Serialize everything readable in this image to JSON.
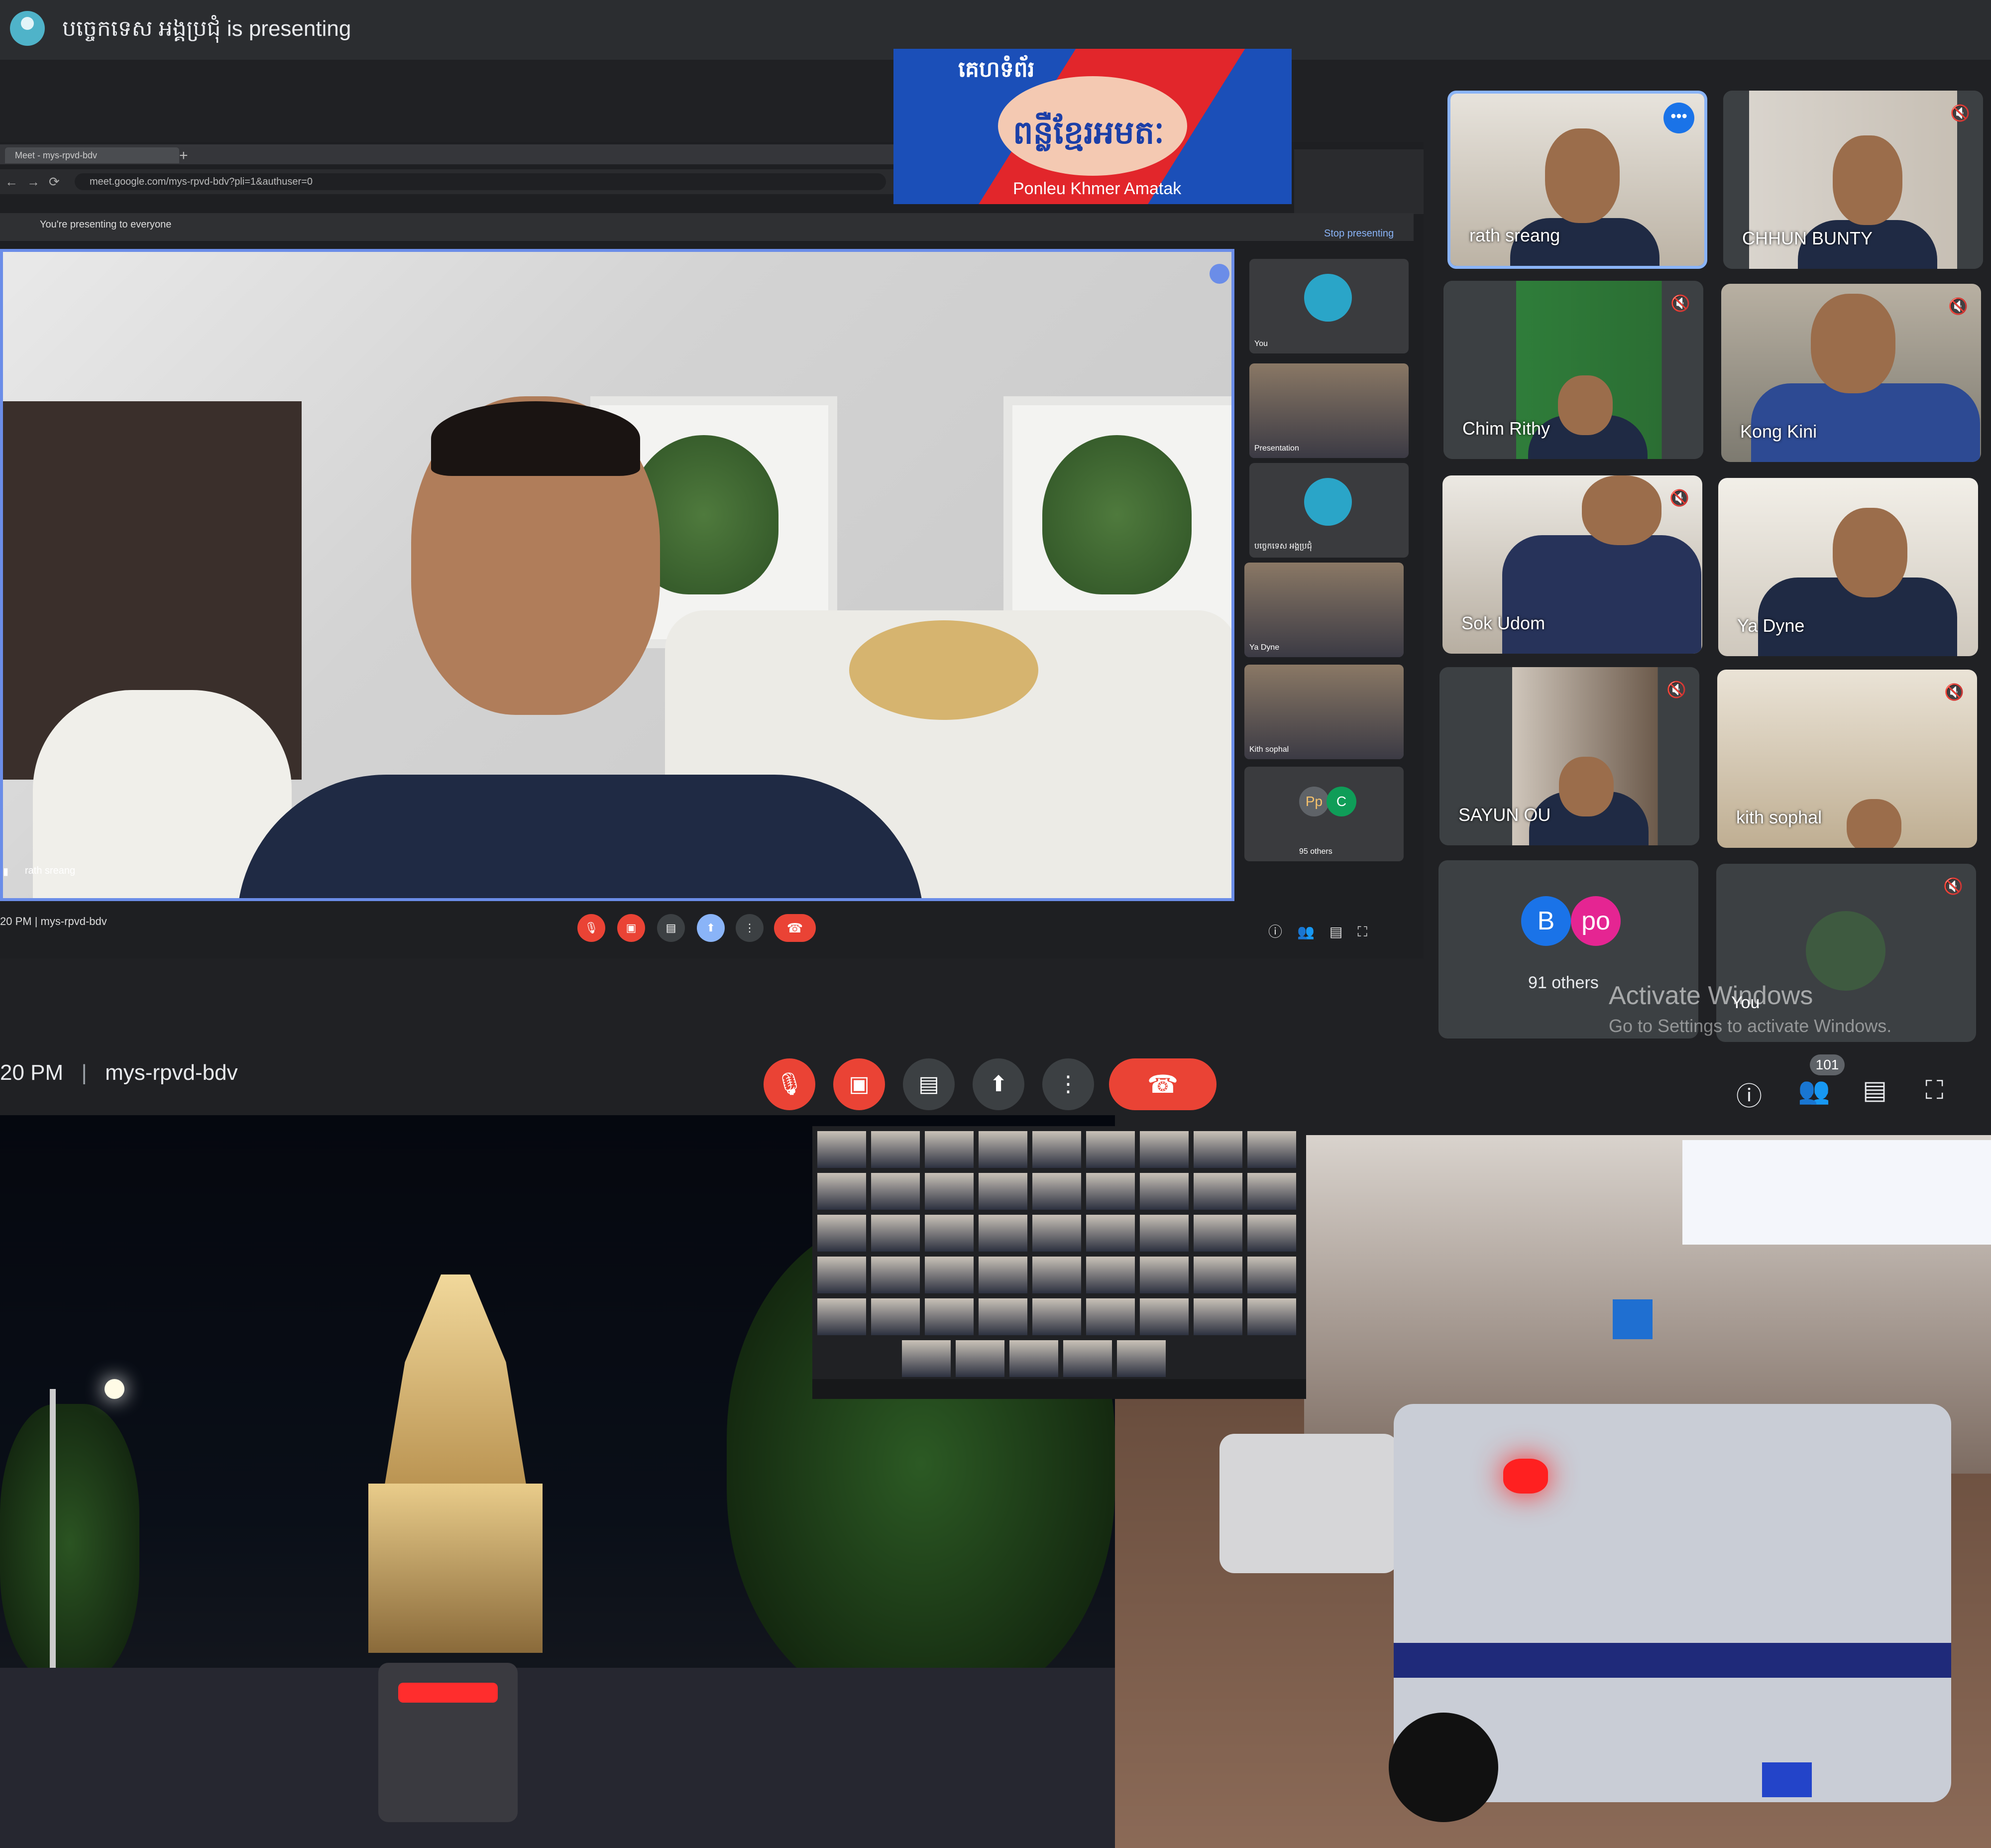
{
  "header": {
    "presenting_text": "បច្ចេកទេស អង្គប្រជុំ is presenting"
  },
  "logo": {
    "top_text": "គេហទំព័រ",
    "main_text": "ពន្លឺខ្មែរអមតៈ",
    "sub_text": "Ponleu Khmer Amatak"
  },
  "shared_screen": {
    "tab_title": "Meet - mys-rpvd-bdv",
    "url": "meet.google.com/mys-rpvd-bdv?pli=1&authuser=0",
    "presenting_bar_text": "You're presenting to everyone",
    "stop_presenting": "Stop presenting",
    "main_speaker_name": "rath sreang",
    "tiles": [
      {
        "name": "You"
      },
      {
        "name": "Presentation"
      },
      {
        "name": "បច្ចេកទេស អង្គប្រជុំ"
      },
      {
        "name": "Ya Dyne"
      },
      {
        "name": "Kith sophal"
      },
      {
        "name": "95 others",
        "avatars": [
          "Pp",
          "C"
        ]
      }
    ],
    "meeting_info": "20 PM | mys-rpvd-bdv"
  },
  "participants": [
    {
      "name": "rath sreang"
    },
    {
      "name": "CHHUN BUNTY"
    },
    {
      "name": "Chim Rithy"
    },
    {
      "name": "Kong Kini"
    },
    {
      "name": "Sok Udom"
    },
    {
      "name": "Ya Dyne"
    },
    {
      "name": "SAYUN OU"
    },
    {
      "name": "kith sophal"
    }
  ],
  "others": {
    "avatar_1": "B",
    "avatar_2": "po",
    "label": "91 others"
  },
  "you_tile": {
    "label": "You"
  },
  "watermark": {
    "line1": "Activate Windows",
    "line2": "Go to Settings to activate Windows."
  },
  "meeting": {
    "time": "20 PM",
    "separator": "|",
    "code": "mys-rpvd-bdv"
  },
  "controls": {
    "mic_icon": "mic-off-icon",
    "camera_icon": "camera-off-icon",
    "captions_icon": "captions-icon",
    "present_icon": "present-screen-icon",
    "more_icon": "more-options-icon",
    "end_icon": "end-call-icon",
    "people_count": "101"
  },
  "colors": {
    "accent_blue": "#8ab4f8",
    "end_red": "#ea4335",
    "background": "#202124"
  }
}
